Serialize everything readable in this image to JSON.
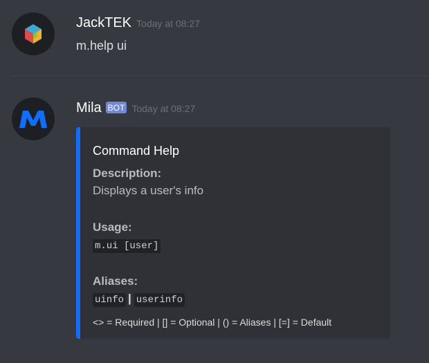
{
  "messages": [
    {
      "author": "JackTEK",
      "timestamp": "Today at 08:27",
      "avatar_icon": "colored-cube-icon",
      "content": "m.help ui"
    },
    {
      "author": "Mila",
      "badge": "BOT",
      "timestamp": "Today at 08:27",
      "avatar_icon": "mila-m-logo-icon",
      "embed": {
        "accent_color": "#0f6efd",
        "title": "Command Help",
        "fields": [
          {
            "name": "Description:",
            "value": "Displays a user's info"
          },
          {
            "name": "Usage:",
            "value": "m.ui [user]"
          },
          {
            "name": "Aliases:",
            "values": [
              "uinfo",
              "userinfo"
            ],
            "separator": "|"
          }
        ],
        "footer": "<> = Required | [] = Optional | () = Aliases | [=] = Default"
      }
    }
  ],
  "colors": {
    "background": "#36393f",
    "embed_background": "#2f3136",
    "bot_badge": "#7289da",
    "mila_logo": "#0f6efd"
  }
}
